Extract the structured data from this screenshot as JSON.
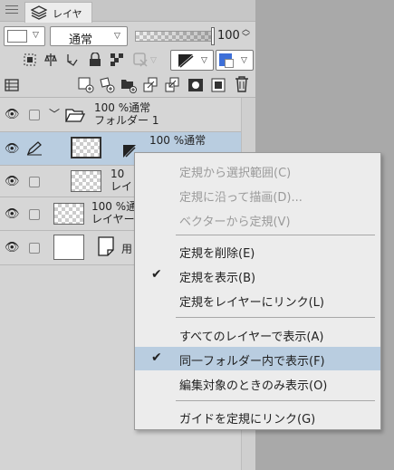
{
  "tab": {
    "label": "レイヤー"
  },
  "toolbar": {
    "blend_mode": "通常",
    "opacity": "100"
  },
  "layers": [
    {
      "percent": "100 %",
      "mode": "通常",
      "name": "フォルダー 1"
    },
    {
      "percent": "100 %",
      "mode": "通常",
      "name": ""
    },
    {
      "percent": "10",
      "name": "レイ"
    },
    {
      "percent": "100 %",
      "mode": "通",
      "name": "レイヤー"
    },
    {
      "name": "用"
    }
  ],
  "menu": {
    "items": [
      {
        "label": "定規から選択範囲(C)"
      },
      {
        "label": "定規に沿って描画(D)..."
      },
      {
        "label": "ベクターから定規(V)"
      },
      {
        "label": "定規を削除(E)"
      },
      {
        "label": "定規を表示(B)"
      },
      {
        "label": "定規をレイヤーにリンク(L)"
      },
      {
        "label": "すべてのレイヤーで表示(A)"
      },
      {
        "label": "同一フォルダー内で表示(F)"
      },
      {
        "label": "編集対象のときのみ表示(O)"
      },
      {
        "label": "ガイドを定規にリンク(G)"
      }
    ],
    "checkmark": "✔"
  }
}
